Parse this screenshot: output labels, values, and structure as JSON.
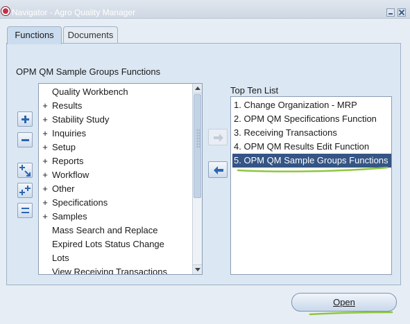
{
  "window": {
    "title": "Navigator - Agro Quality Manager"
  },
  "tabs": [
    {
      "label": "Functions",
      "active": true
    },
    {
      "label": "Documents",
      "active": false
    }
  ],
  "functions_panel": {
    "heading": "OPM QM Sample Groups Functions",
    "tree": [
      {
        "label": "Quality Workbench",
        "expandable": false
      },
      {
        "label": "Results",
        "expandable": true
      },
      {
        "label": "Stability Study",
        "expandable": true
      },
      {
        "label": "Inquiries",
        "expandable": true
      },
      {
        "label": "Setup",
        "expandable": true
      },
      {
        "label": "Reports",
        "expandable": true
      },
      {
        "label": "Workflow",
        "expandable": true
      },
      {
        "label": "Other",
        "expandable": true
      },
      {
        "label": "Specifications",
        "expandable": true
      },
      {
        "label": "Samples",
        "expandable": true
      },
      {
        "label": "Mass Search and Replace",
        "expandable": false
      },
      {
        "label": "Expired Lots Status Change",
        "expandable": false
      },
      {
        "label": "Lots",
        "expandable": false
      },
      {
        "label": "View Receiving Transactions",
        "expandable": false
      }
    ],
    "expand_marker": "+"
  },
  "top_ten": {
    "heading": "Top Ten List",
    "items": [
      "1. Change Organization - MRP",
      "2. OPM QM Specifications Function",
      "3. Receiving Transactions",
      "4. OPM QM Results Edit Function",
      "5. OPM QM Sample Groups Functions"
    ],
    "selected_index": 4
  },
  "buttons": {
    "open_label": "Open"
  },
  "icons": {
    "expand": "expand-icon",
    "collapse": "collapse-icon",
    "expand_branch": "expand-branch-icon",
    "expand_all": "expand-all-icon",
    "collapse_all": "collapse-all-icon",
    "add_to_list": "arrow-right-icon",
    "remove_from_list": "arrow-left-icon"
  },
  "colors": {
    "selection": "#355585",
    "annotation": "#8dc63f",
    "accent_blue": "#2b66b1"
  }
}
